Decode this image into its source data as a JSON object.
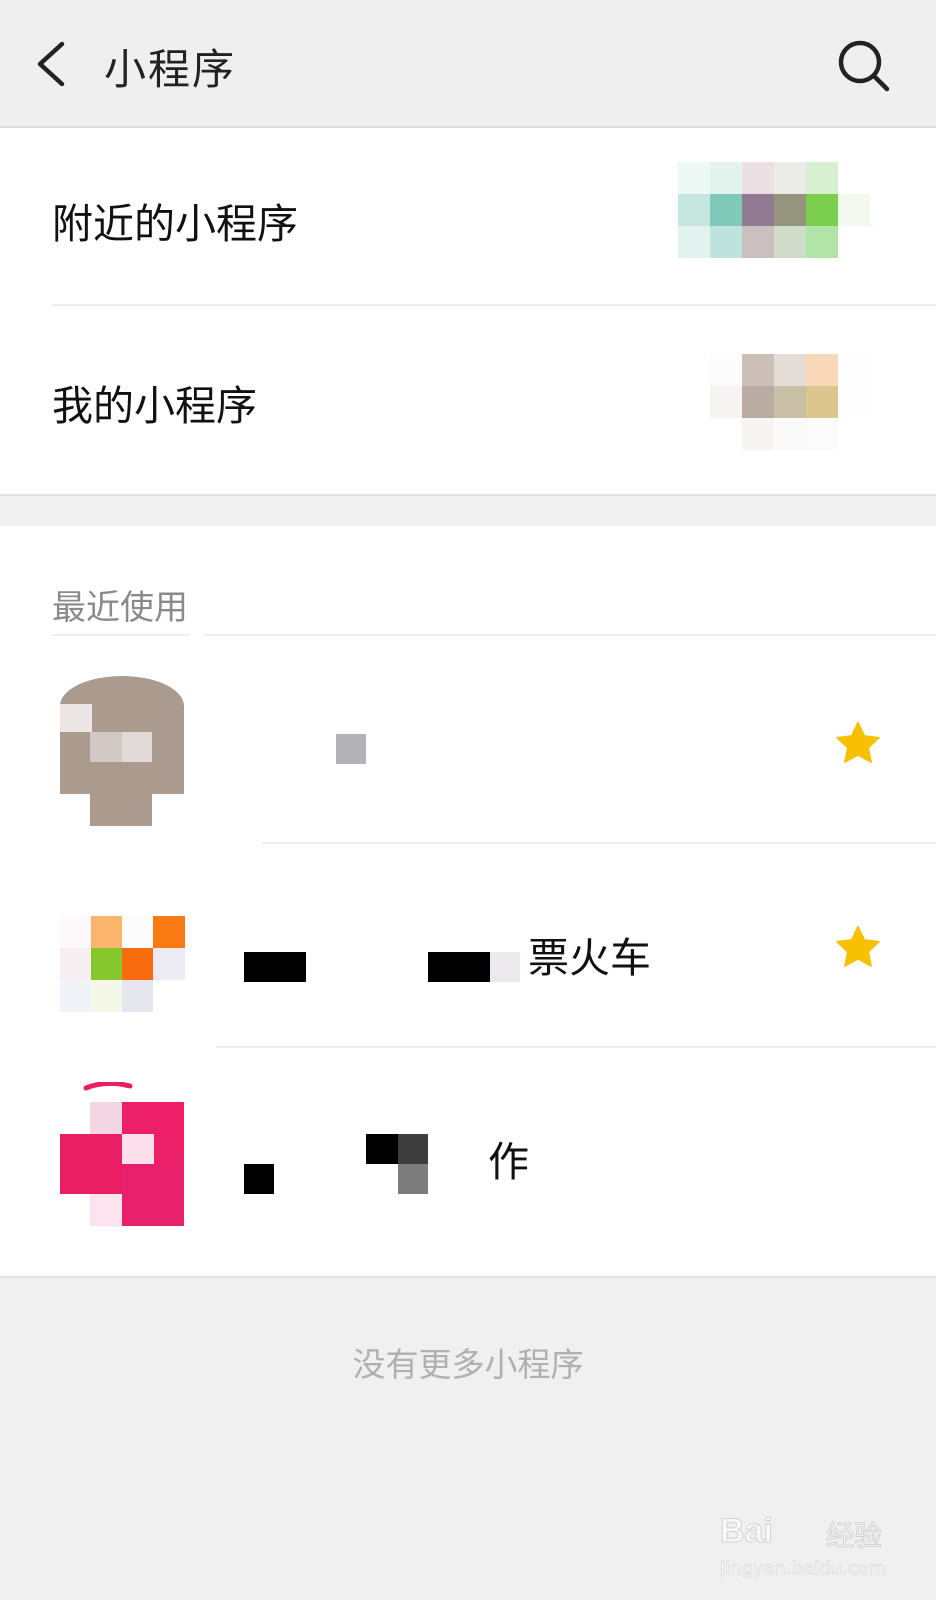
{
  "header": {
    "title": "小程序"
  },
  "entries": [
    {
      "label": "附近的小程序"
    },
    {
      "label": "我的小程序"
    }
  ],
  "recent": {
    "section_title": "最近使用",
    "items": [
      {
        "name": "",
        "starred": true
      },
      {
        "name": "票火车",
        "starred": true
      },
      {
        "name": "作",
        "starred": false
      }
    ]
  },
  "footer": {
    "no_more": "没有更多小程序"
  },
  "watermark": {
    "logo": "Bai",
    "jy": "经验",
    "url": "jingyan.baidu.com"
  },
  "colors": {
    "star": "#f7c000",
    "background": "#f0f0f0",
    "card": "#ffffff"
  }
}
